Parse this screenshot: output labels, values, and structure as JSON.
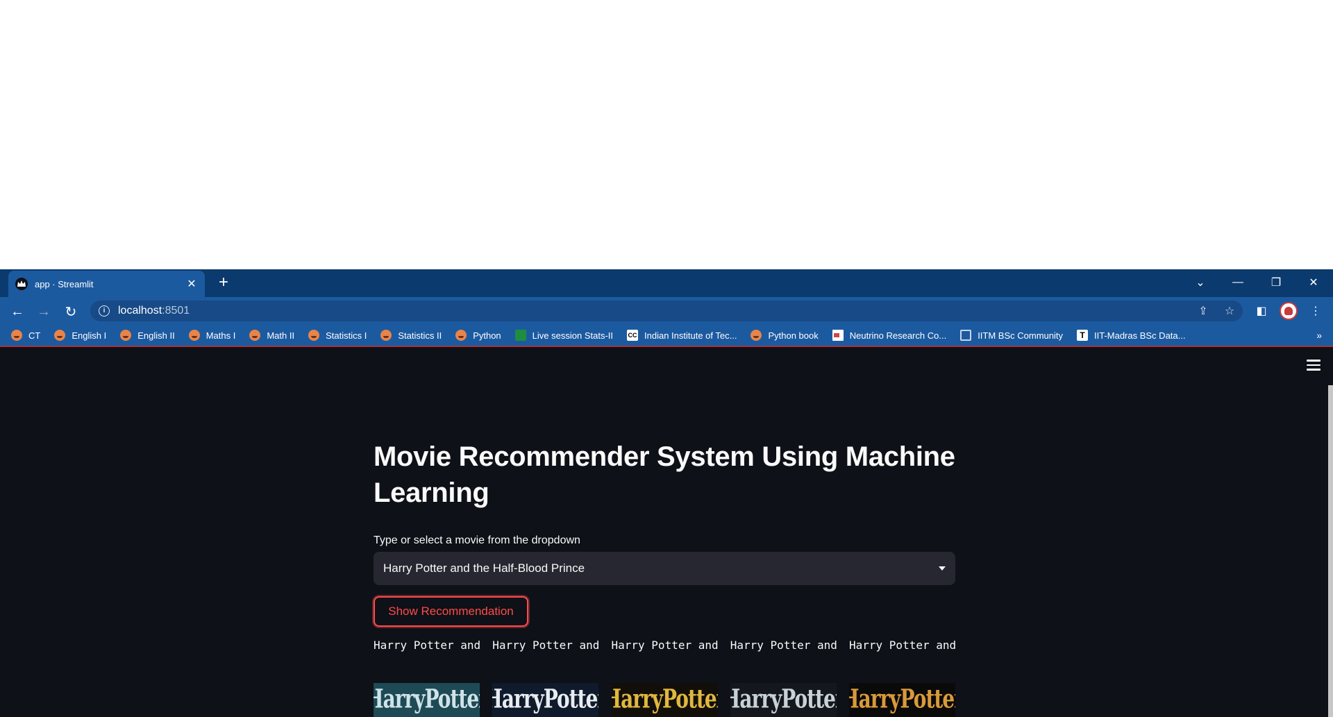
{
  "browser": {
    "tab_title": "app · Streamlit",
    "tab_close": "✕",
    "new_tab": "+",
    "url_host": "localhost",
    "url_port": ":8501",
    "bookmarks": [
      {
        "label": "CT",
        "icon": "face"
      },
      {
        "label": "English I",
        "icon": "face"
      },
      {
        "label": "English II",
        "icon": "face"
      },
      {
        "label": "Maths I",
        "icon": "face"
      },
      {
        "label": "Math II",
        "icon": "face"
      },
      {
        "label": "Statistics I",
        "icon": "face"
      },
      {
        "label": "Statistics II",
        "icon": "face"
      },
      {
        "label": "Python",
        "icon": "face"
      },
      {
        "label": "Live session Stats-II",
        "icon": "green"
      },
      {
        "label": "Indian Institute of Tec...",
        "icon": "cc"
      },
      {
        "label": "Python book",
        "icon": "face"
      },
      {
        "label": "Neutrino Research Co...",
        "icon": "red"
      },
      {
        "label": "IITM BSc Community",
        "icon": "cal"
      },
      {
        "label": "IIT-Madras BSc Data...",
        "icon": "tee"
      }
    ],
    "bookmarks_more": "»"
  },
  "app": {
    "title": "Movie Recommender System Using Machine Learning",
    "select_label": "Type or select a movie from the dropdown",
    "selected_movie": "Harry Potter and the Half-Blood Prince",
    "button_label": "Show Recommendation",
    "recommendations": [
      {
        "name": "Harry Potter and",
        "poster_text": "HarryPotter",
        "poster_bg": "#1d4a55",
        "poster_fg": "#cfe3e8"
      },
      {
        "name": "Harry Potter and",
        "poster_text": "HarryPotter",
        "poster_bg": "#0f1b2c",
        "poster_fg": "#e8ecf0"
      },
      {
        "name": "Harry Potter and",
        "poster_text": "HarryPotter",
        "poster_bg": "#120f0a",
        "poster_fg": "#e0b840"
      },
      {
        "name": "Harry Potter and",
        "poster_text": "HarryPotter",
        "poster_bg": "#14181e",
        "poster_fg": "#c9d2d8"
      },
      {
        "name": "Harry Potter and",
        "poster_text": "HarryPotter",
        "poster_bg": "#0b0a0a",
        "poster_fg": "#d99a3a"
      }
    ]
  },
  "colors": {
    "accent": "#ff4b4b",
    "background": "#0e1117",
    "select_bg": "#262730",
    "browser_frame": "#1c5aa0"
  }
}
